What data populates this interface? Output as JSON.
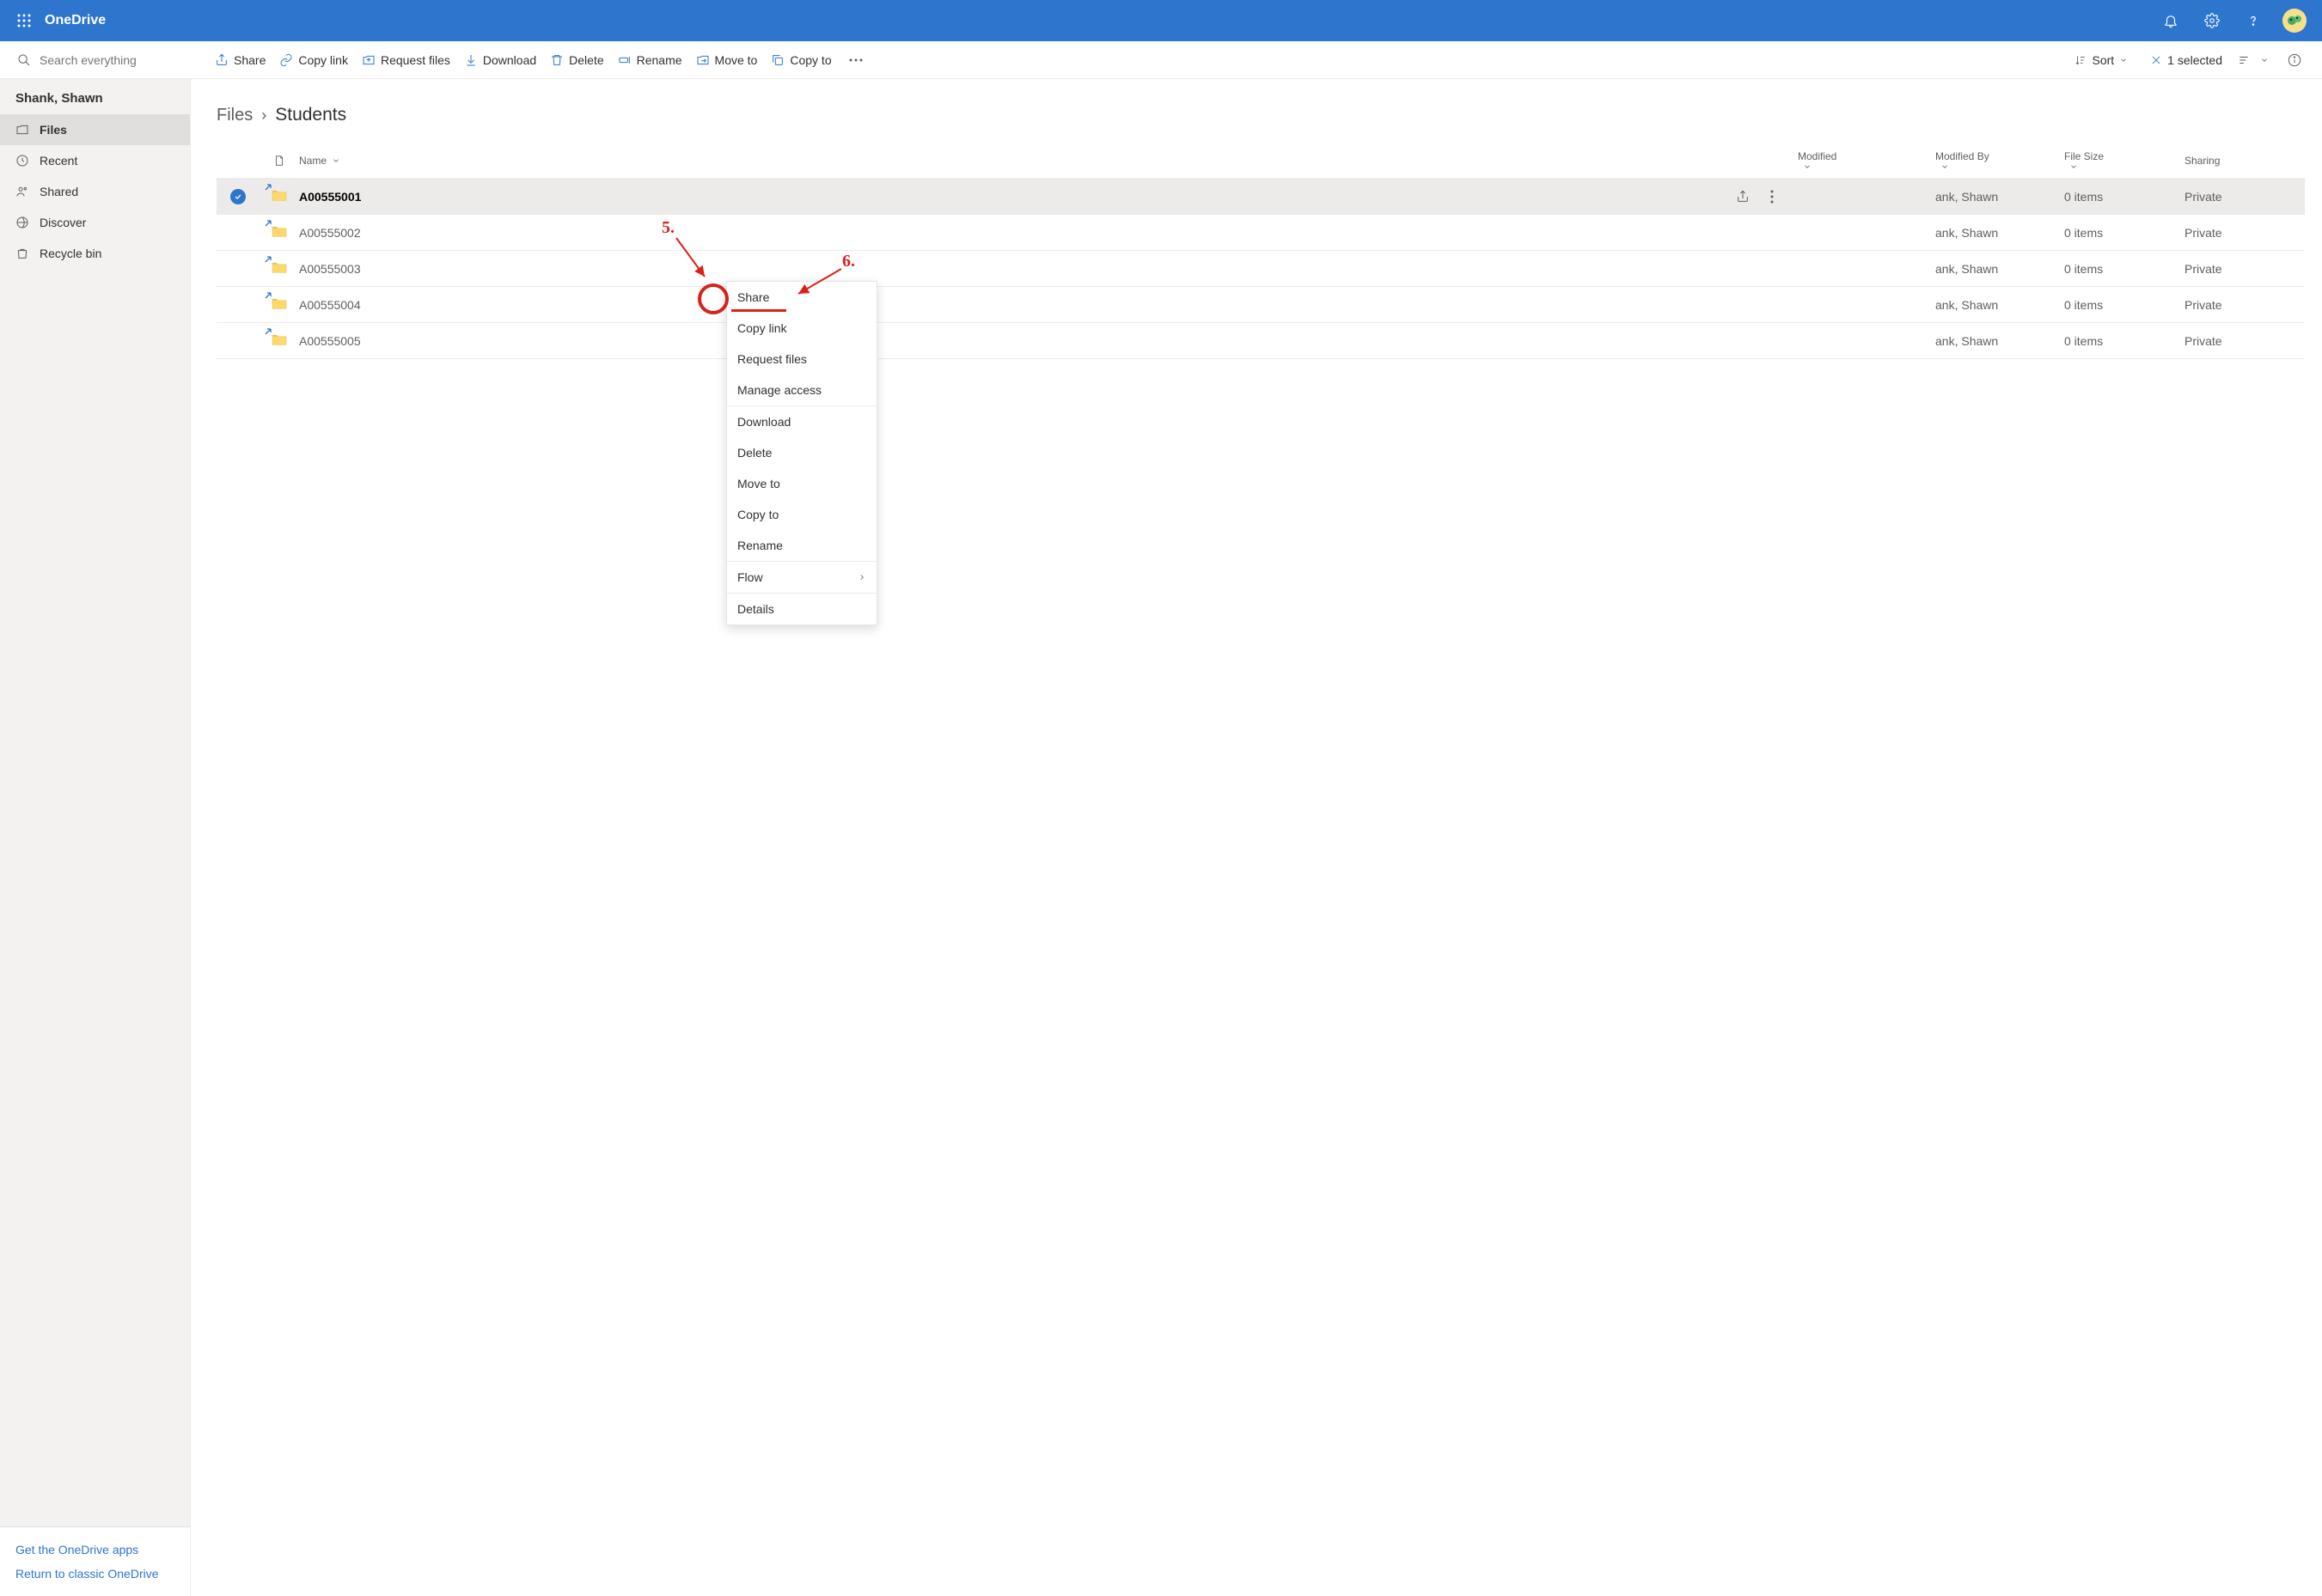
{
  "header": {
    "app_name": "OneDrive"
  },
  "search": {
    "placeholder": "Search everything"
  },
  "commands": {
    "share": "Share",
    "copy_link": "Copy link",
    "request_files": "Request files",
    "download": "Download",
    "delete": "Delete",
    "rename": "Rename",
    "move_to": "Move to",
    "copy_to": "Copy to",
    "sort": "Sort",
    "selected": "1 selected"
  },
  "sidebar": {
    "user": "Shank, Shawn",
    "items": [
      "Files",
      "Recent",
      "Shared",
      "Discover",
      "Recycle bin"
    ],
    "bottom": {
      "get_apps": "Get the OneDrive apps",
      "classic": "Return to classic OneDrive"
    }
  },
  "breadcrumb": {
    "root": "Files",
    "current": "Students"
  },
  "columns": {
    "name": "Name",
    "modified": "Modified",
    "modified_by": "Modified By",
    "file_size": "File Size",
    "sharing": "Sharing"
  },
  "rows": [
    {
      "name": "A00555001",
      "modified": "",
      "modified_by": "ank, Shawn",
      "size": "0 items",
      "sharing": "Private",
      "selected": true
    },
    {
      "name": "A00555002",
      "modified": "",
      "modified_by": "ank, Shawn",
      "size": "0 items",
      "sharing": "Private",
      "selected": false
    },
    {
      "name": "A00555003",
      "modified": "",
      "modified_by": "ank, Shawn",
      "size": "0 items",
      "sharing": "Private",
      "selected": false
    },
    {
      "name": "A00555004",
      "modified": "",
      "modified_by": "ank, Shawn",
      "size": "0 items",
      "sharing": "Private",
      "selected": false
    },
    {
      "name": "A00555005",
      "modified": "",
      "modified_by": "ank, Shawn",
      "size": "0 items",
      "sharing": "Private",
      "selected": false
    }
  ],
  "context_menu": {
    "items": [
      "Share",
      "Copy link",
      "Request files",
      "Manage access",
      "Download",
      "Delete",
      "Move to",
      "Copy to",
      "Rename",
      "Flow",
      "Details"
    ]
  },
  "annotations": {
    "five": "5.",
    "six": "6."
  }
}
